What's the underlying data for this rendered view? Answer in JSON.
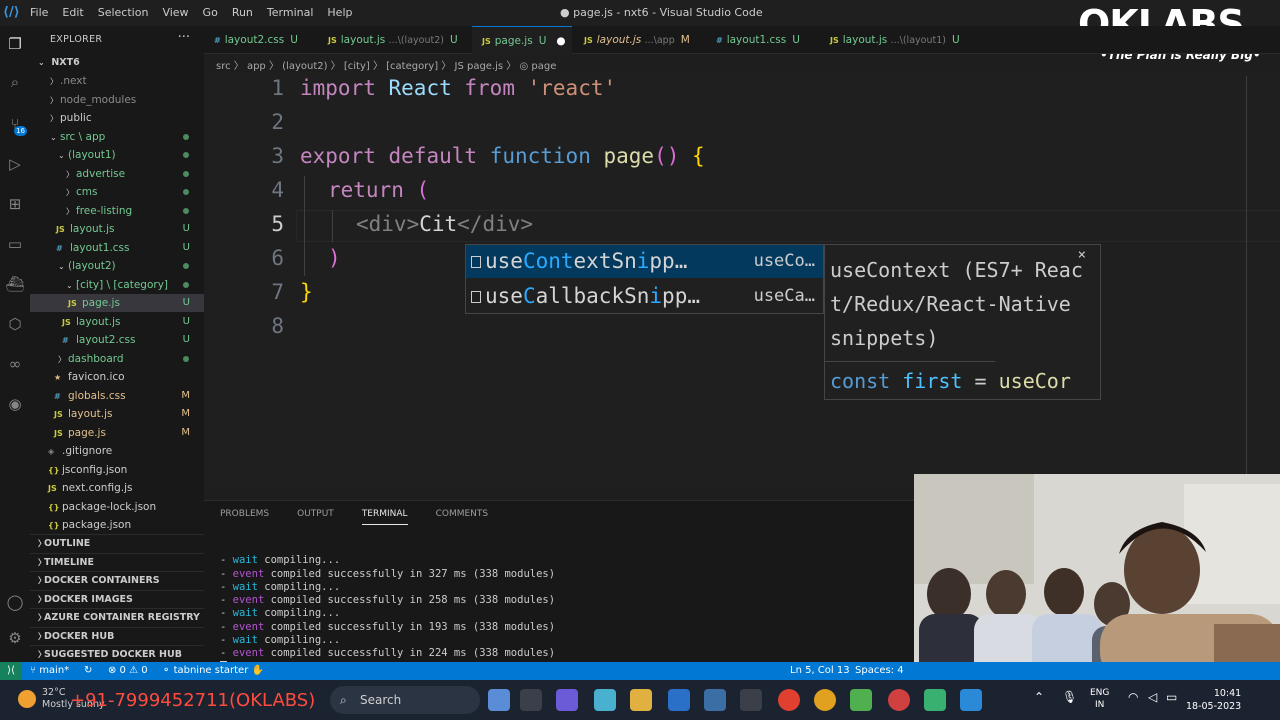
{
  "window": {
    "menu": [
      "File",
      "Edit",
      "Selection",
      "View",
      "Go",
      "Run",
      "Terminal",
      "Help"
    ],
    "title": "● page.js - nxt6 - Visual Studio Code"
  },
  "watermark": {
    "title": "OKLABS",
    "subtitle": "•The Plan is Really Big•"
  },
  "activity": {
    "badge": "16"
  },
  "explorer": {
    "header": "EXPLORER",
    "more": "···",
    "root": "NXT6",
    "rows": [
      {
        "label": ".next",
        "status": ""
      },
      {
        "label": "node_modules",
        "status": ""
      },
      {
        "label": "public",
        "status": ""
      },
      {
        "label": "src \\ app",
        "status": ""
      },
      {
        "label": "(layout1)",
        "status": ""
      },
      {
        "label": "advertise",
        "status": ""
      },
      {
        "label": "cms",
        "status": ""
      },
      {
        "label": "free-listing",
        "status": ""
      },
      {
        "label": "layout.js",
        "status": "U"
      },
      {
        "label": "layout1.css",
        "status": "U"
      },
      {
        "label": "(layout2)",
        "status": ""
      },
      {
        "label": "[city] \\ [category]",
        "status": ""
      },
      {
        "label": "page.js",
        "status": "U"
      },
      {
        "label": "layout.js",
        "status": "U"
      },
      {
        "label": "layout2.css",
        "status": "U"
      },
      {
        "label": "dashboard",
        "status": ""
      },
      {
        "label": "favicon.ico",
        "status": ""
      },
      {
        "label": "globals.css",
        "status": "M"
      },
      {
        "label": "layout.js",
        "status": "M"
      },
      {
        "label": "page.js",
        "status": "M"
      },
      {
        "label": ".gitignore",
        "status": ""
      },
      {
        "label": "jsconfig.json",
        "status": ""
      },
      {
        "label": "next.config.js",
        "status": ""
      },
      {
        "label": "package-lock.json",
        "status": ""
      },
      {
        "label": "package.json",
        "status": ""
      }
    ],
    "sections": [
      "OUTLINE",
      "TIMELINE",
      "DOCKER CONTAINERS",
      "DOCKER IMAGES",
      "AZURE CONTAINER REGISTRY",
      "DOCKER HUB",
      "SUGGESTED DOCKER HUB IMAGES"
    ]
  },
  "tabs": [
    {
      "name": "layout2.css",
      "sub": "",
      "mod": "U"
    },
    {
      "name": "layout.js",
      "sub": "...\\(layout2)",
      "mod": "U"
    },
    {
      "name": "page.js",
      "sub": "",
      "mod": "U"
    },
    {
      "name": "layout.js",
      "sub": "...\\app",
      "mod": "M"
    },
    {
      "name": "layout1.css",
      "sub": "",
      "mod": "U"
    },
    {
      "name": "layout.js",
      "sub": "...\\(layout1)",
      "mod": "U"
    }
  ],
  "breadcrumb": "src 〉 app 〉 (layout2) 〉 [city] 〉 [category] 〉 JS page.js 〉 ◎ page",
  "editor": {
    "line_numbers": [
      "1",
      "2",
      "3",
      "4",
      "5",
      "6",
      "7",
      "8"
    ],
    "code": {
      "l1_import": "import",
      "l1_react": "React",
      "l1_from": "from",
      "l1_str": "'react'",
      "l3_export": "export",
      "l3_default": "default",
      "l3_function": "function",
      "l3_name": "page",
      "l3_paren": "()",
      "l3_brace": "{",
      "l4_return": "return",
      "l4_paren": "(",
      "l5_open": "<div>",
      "l5_text": "Cit",
      "l5_close": "</div>",
      "l6_paren": ")",
      "l7_brace": "}"
    }
  },
  "suggest": {
    "items": [
      {
        "a": "use",
        "b": "Con",
        "c": "",
        "d": "t",
        "e": "extSn",
        "f": "i",
        "g": "pp…",
        "detail": "useCo…"
      },
      {
        "a": "use",
        "b": "C",
        "c": "allbackSn",
        "d": "i",
        "e": "pp…",
        "detail": "useCa…"
      }
    ],
    "details": {
      "desc": "useContext (ES7+ React/Redux/React-Native snippets)",
      "snippet_const": "const",
      "snippet_var": "first",
      "snippet_eq": "=",
      "snippet_fn": "useCor",
      "close": "×"
    }
  },
  "panel": {
    "tabs": [
      "PROBLEMS",
      "OUTPUT",
      "TERMINAL",
      "COMMENTS"
    ],
    "terminal": [
      {
        "kind": "wait",
        "text": "compiling..."
      },
      {
        "kind": "event",
        "text": "compiled successfully in 327 ms (338 modules)"
      },
      {
        "kind": "wait",
        "text": "compiling..."
      },
      {
        "kind": "event",
        "text": "compiled successfully in 258 ms (338 modules)"
      },
      {
        "kind": "wait",
        "text": "compiling..."
      },
      {
        "kind": "event",
        "text": "compiled successfully in 193 ms (338 modules)"
      },
      {
        "kind": "wait",
        "text": "compiling..."
      },
      {
        "kind": "event",
        "text": "compiled successfully in 224 ms (338 modules)"
      }
    ]
  },
  "statusbar": {
    "branch": "main*",
    "problems": "⊗ 0 ⚠ 0",
    "tabnine": "tabnine starter",
    "position": "Ln 5, Col 13",
    "spaces": "Spaces: 4"
  },
  "taskbar": {
    "temp": "32°C",
    "weather": "Mostly sunny",
    "phone": "+91-7999452711(OKLABS)",
    "search": "Search",
    "lang1": "ENG",
    "lang2": "IN",
    "time": "10:41",
    "date": "18-05-2023"
  }
}
